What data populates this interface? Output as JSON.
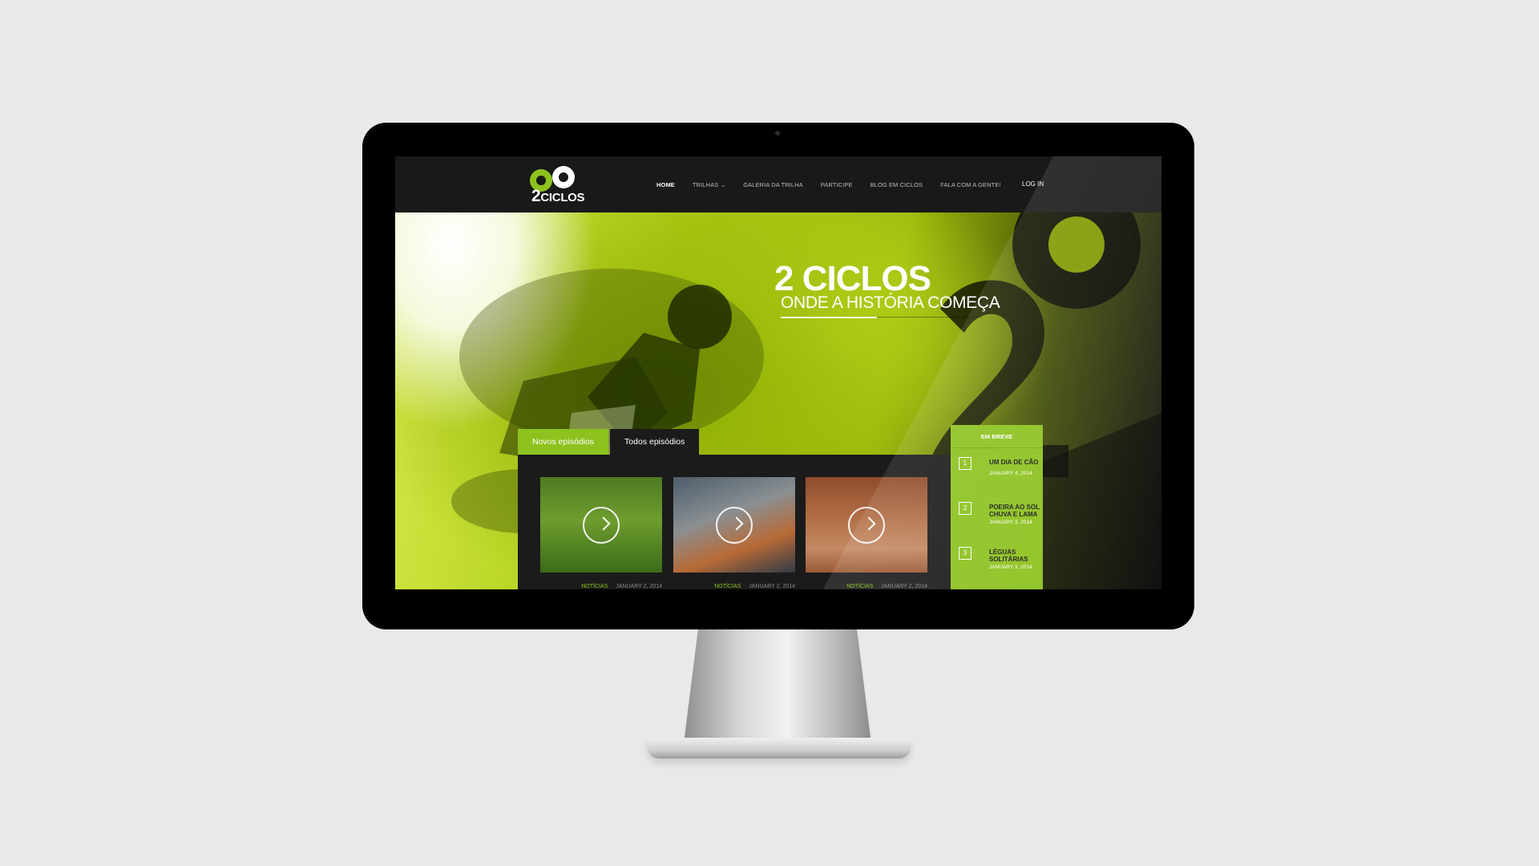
{
  "header": {
    "logo_text_num": "2",
    "logo_text": "CICLOS",
    "nav": [
      {
        "label": "HOME",
        "active": true
      },
      {
        "label": "TRILHAS",
        "has_dropdown": true
      },
      {
        "label": "GALERIA DA TRILHA"
      },
      {
        "label": "PARTICIPE"
      },
      {
        "label": "BLOG EM CICLOS"
      },
      {
        "label": "FALA COM A GENTE!"
      }
    ],
    "login": "LOG IN"
  },
  "hero": {
    "title": "2 CICLOS",
    "subtitle": "ONDE A HISTÓRIA COMEÇA"
  },
  "episodes": {
    "tabs": [
      "Novos episódios",
      "Todos episódios"
    ],
    "items": [
      {
        "category": "NOTÍCIAS",
        "date": "JANUARY 2, 2014"
      },
      {
        "category": "NOTÍCIAS",
        "date": "JANUARY 2, 2014"
      },
      {
        "category": "NOTÍCIAS",
        "date": "JANUARY 2, 2014"
      }
    ]
  },
  "em_breve": {
    "title": "EM BREVE",
    "items": [
      {
        "num": "1",
        "title": "UM DIA DE CÃO",
        "date": "JANUARY 4, 2014"
      },
      {
        "num": "2",
        "title": "POEIRA AO SOL CHUVA E LAMA",
        "date": "JANUARY 3, 2014"
      },
      {
        "num": "3",
        "title": "LÉGUAS SOLITÁRIAS",
        "date": "JANUARY 3, 2014"
      }
    ]
  },
  "colors": {
    "accent": "#8dc21f",
    "header_bg": "#191919",
    "panel_bg": "#1b1b1b",
    "page_bg": "#e9e9e9"
  }
}
